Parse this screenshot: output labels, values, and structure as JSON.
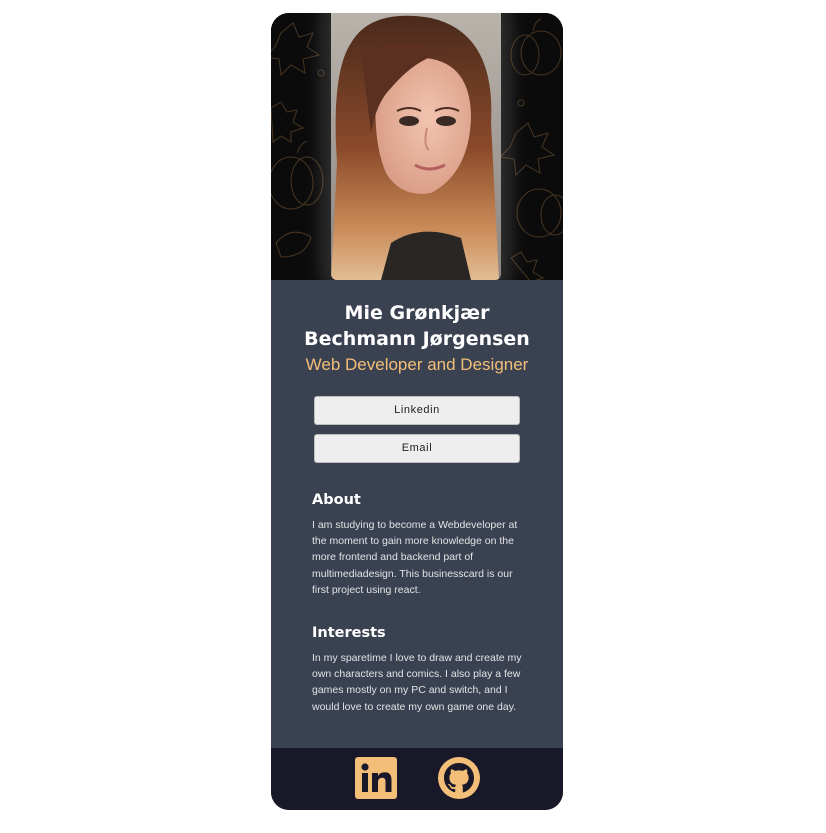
{
  "profile": {
    "name": "Mie Grønkjær Bechmann Jørgensen",
    "title": "Web Developer and Designer"
  },
  "buttons": {
    "linkedin_label": "Linkedin",
    "email_label": "Email"
  },
  "about": {
    "heading": "About",
    "text": "I am studying to become a Webdeveloper at the moment to gain more knowledge on the more frontend and backend part of multimediadesign. This businesscard is our first project using react."
  },
  "interests": {
    "heading": "Interests",
    "text": "In my sparetime I love to draw and create my own characters and comics. I also play a few games mostly on my PC and switch, and I would love to create my own game one day."
  },
  "footer": {
    "icons": [
      "linkedin-icon",
      "github-icon"
    ]
  },
  "colors": {
    "card_bg": "#3a4252",
    "footer_bg": "#181829",
    "accent": "#f3bf78",
    "button_bg": "#eeeeee"
  }
}
